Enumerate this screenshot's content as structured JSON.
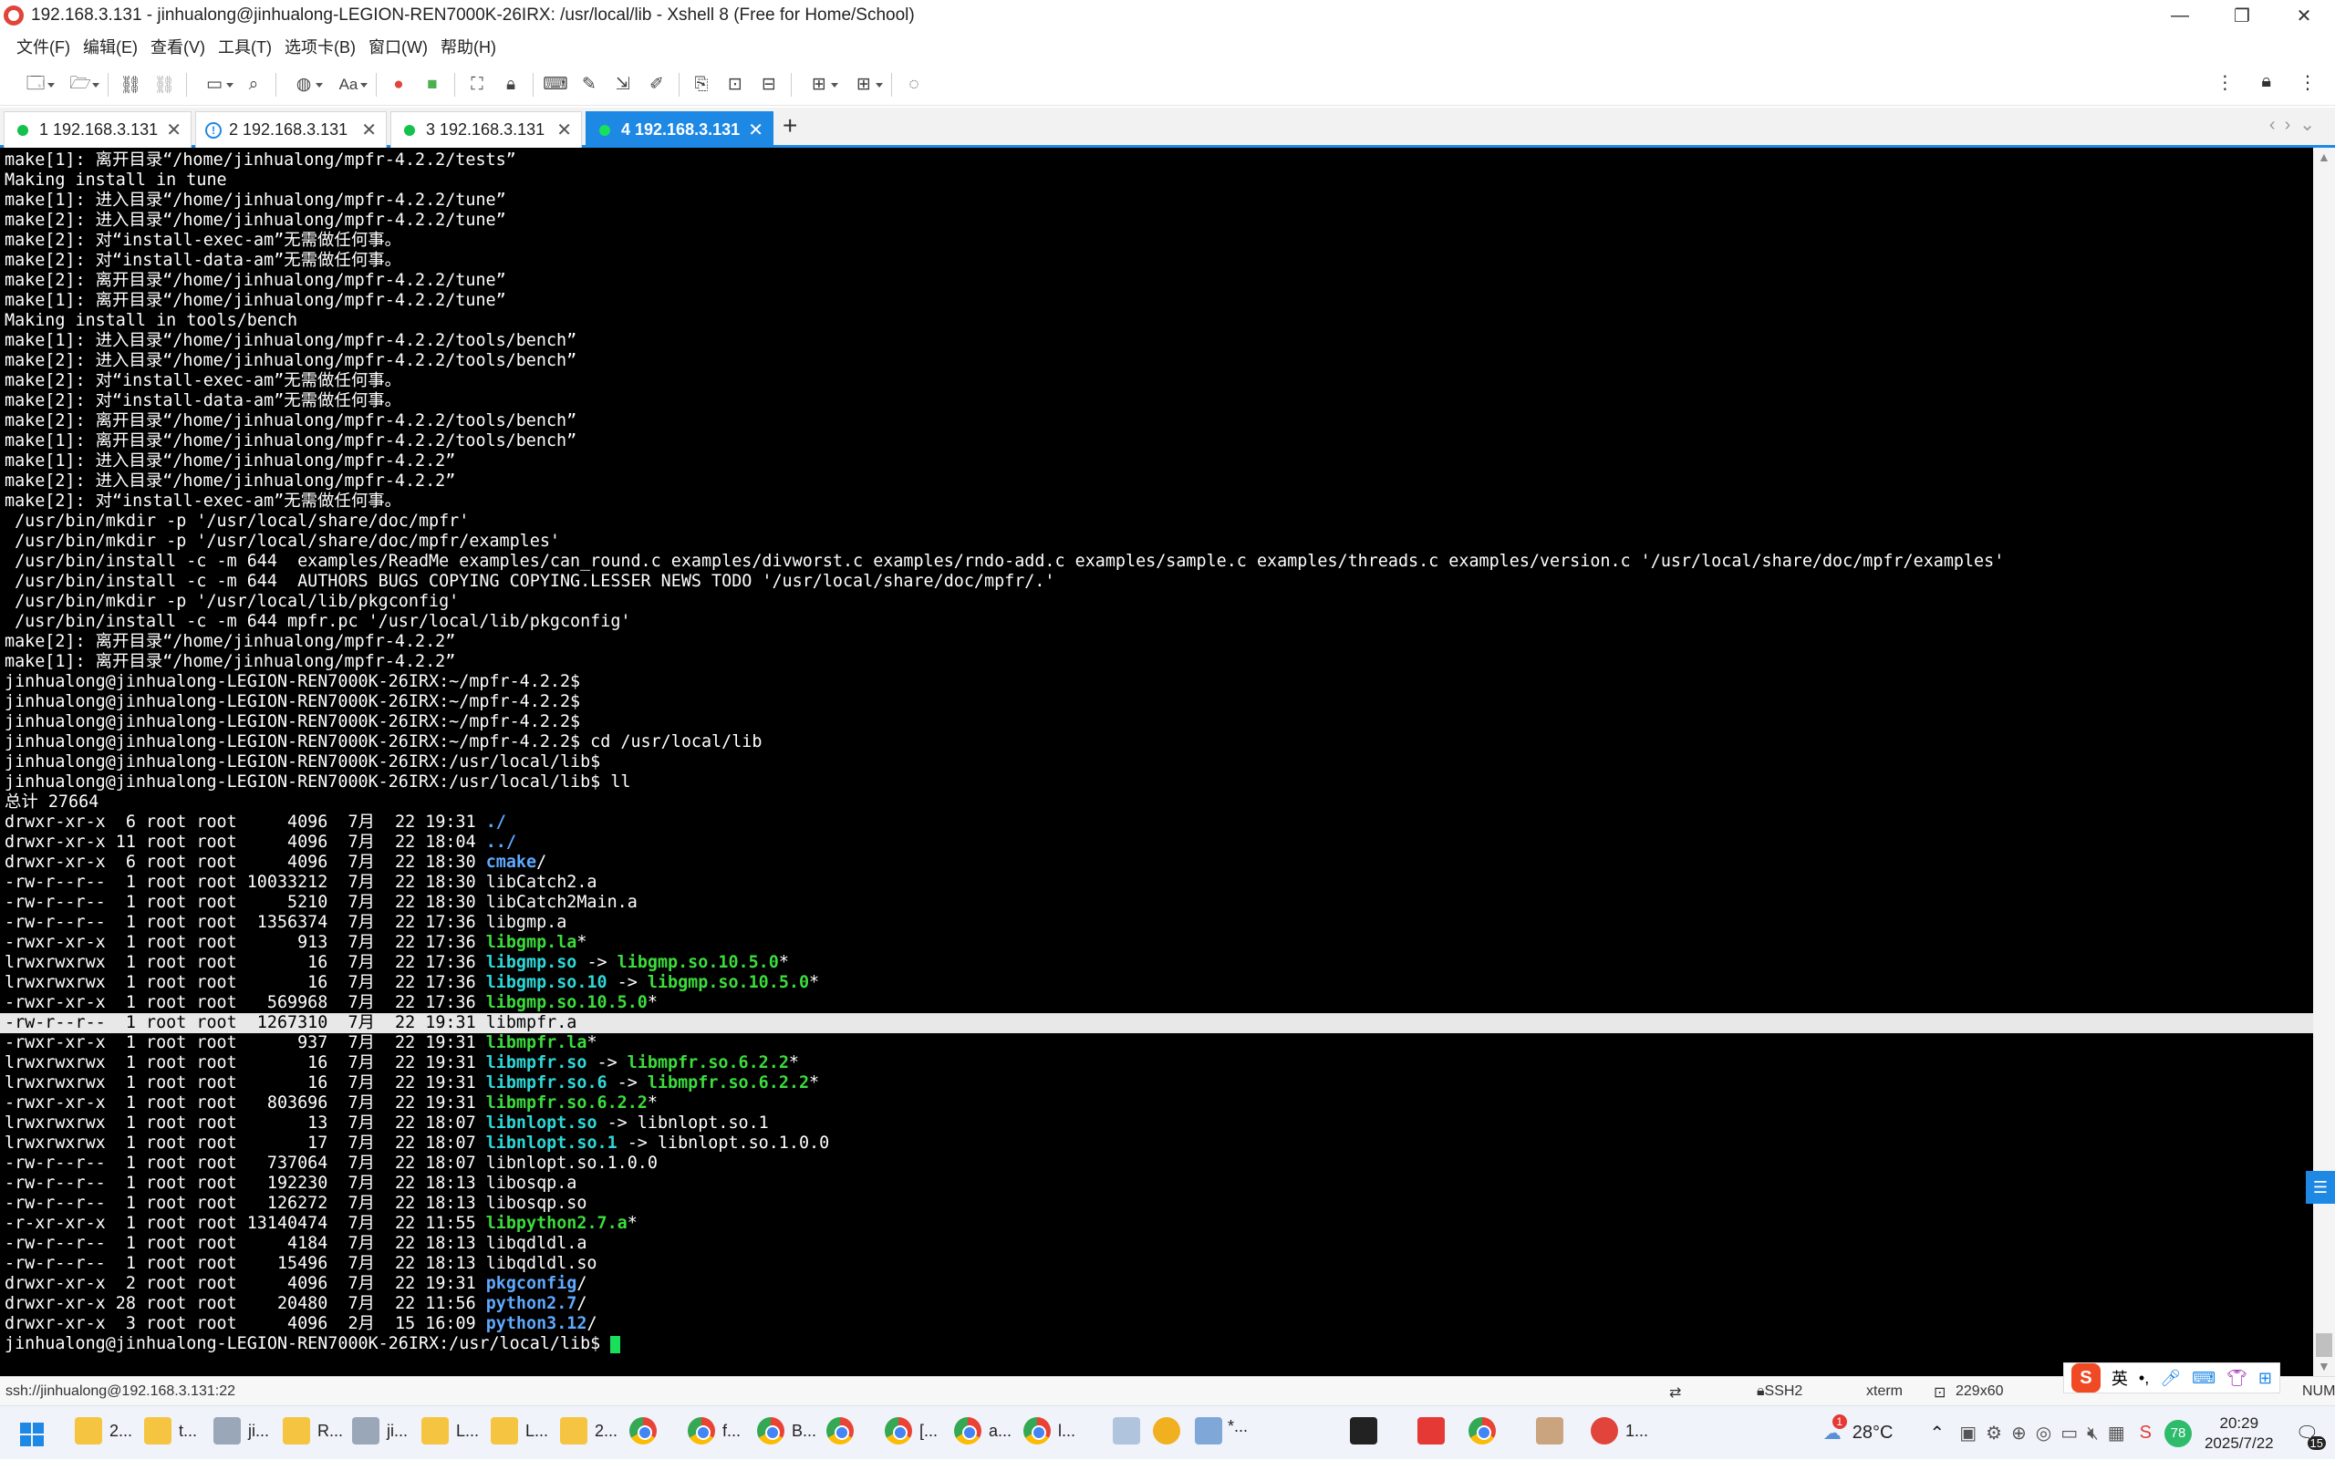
{
  "window": {
    "title": "192.168.3.131 - jinhualong@jinhualong-LEGION-REN7000K-26IRX: /usr/local/lib - Xshell 8 (Free for Home/School)",
    "controls": {
      "minimize": "—",
      "maximize": "❐",
      "close": "✕"
    }
  },
  "menu": [
    "文件(F)",
    "编辑(E)",
    "查看(V)",
    "工具(T)",
    "选项卡(B)",
    "窗口(W)",
    "帮助(H)"
  ],
  "toolbar": {
    "buttons": [
      "new-session-icon",
      "open-icon",
      "connect-icon",
      "disconnect-icon",
      "new-window-icon",
      "find-icon",
      "globe-icon",
      "font-icon",
      "xftp-icon",
      "xmanager-icon",
      "fullscreen-icon",
      "lock-icon",
      "keyboard-icon",
      "compose-icon",
      "script-icon",
      "macro-icon",
      "log-icon",
      "tile-icon",
      "transfer-icon",
      "layout-icon",
      "chat-icon"
    ],
    "font_label": "Aa",
    "right": [
      "more-icon",
      "lock-icon"
    ]
  },
  "tabs": [
    {
      "label": "1 192.168.3.131",
      "state": "connected"
    },
    {
      "label": "2 192.168.3.131",
      "state": "warning"
    },
    {
      "label": "3 192.168.3.131",
      "state": "connected"
    },
    {
      "label": "4 192.168.3.131",
      "state": "active"
    }
  ],
  "terminal": {
    "lines": [
      [
        [
          "make[1]: 离开目录“/home/jinhualong/mpfr-4.2.2/tests”",
          ""
        ]
      ],
      [
        [
          "Making install in tune",
          ""
        ]
      ],
      [
        [
          "make[1]: 进入目录“/home/jinhualong/mpfr-4.2.2/tune”",
          ""
        ]
      ],
      [
        [
          "make[2]: 进入目录“/home/jinhualong/mpfr-4.2.2/tune”",
          ""
        ]
      ],
      [
        [
          "make[2]: 对“install-exec-am”无需做任何事。",
          ""
        ]
      ],
      [
        [
          "make[2]: 对“install-data-am”无需做任何事。",
          ""
        ]
      ],
      [
        [
          "make[2]: 离开目录“/home/jinhualong/mpfr-4.2.2/tune”",
          ""
        ]
      ],
      [
        [
          "make[1]: 离开目录“/home/jinhualong/mpfr-4.2.2/tune”",
          ""
        ]
      ],
      [
        [
          "Making install in tools/bench",
          ""
        ]
      ],
      [
        [
          "make[1]: 进入目录“/home/jinhualong/mpfr-4.2.2/tools/bench”",
          ""
        ]
      ],
      [
        [
          "make[2]: 进入目录“/home/jinhualong/mpfr-4.2.2/tools/bench”",
          ""
        ]
      ],
      [
        [
          "make[2]: 对“install-exec-am”无需做任何事。",
          ""
        ]
      ],
      [
        [
          "make[2]: 对“install-data-am”无需做任何事。",
          ""
        ]
      ],
      [
        [
          "make[2]: 离开目录“/home/jinhualong/mpfr-4.2.2/tools/bench”",
          ""
        ]
      ],
      [
        [
          "make[1]: 离开目录“/home/jinhualong/mpfr-4.2.2/tools/bench”",
          ""
        ]
      ],
      [
        [
          "make[1]: 进入目录“/home/jinhualong/mpfr-4.2.2”",
          ""
        ]
      ],
      [
        [
          "make[2]: 进入目录“/home/jinhualong/mpfr-4.2.2”",
          ""
        ]
      ],
      [
        [
          "make[2]: 对“install-exec-am”无需做任何事。",
          ""
        ]
      ],
      [
        [
          " /usr/bin/mkdir -p '/usr/local/share/doc/mpfr'",
          ""
        ]
      ],
      [
        [
          " /usr/bin/mkdir -p '/usr/local/share/doc/mpfr/examples'",
          ""
        ]
      ],
      [
        [
          " /usr/bin/install -c -m 644  examples/ReadMe examples/can_round.c examples/divworst.c examples/rndo-add.c examples/sample.c examples/threads.c examples/version.c '/usr/local/share/doc/mpfr/examples'",
          ""
        ]
      ],
      [
        [
          " /usr/bin/install -c -m 644  AUTHORS BUGS COPYING COPYING.LESSER NEWS TODO '/usr/local/share/doc/mpfr/.'",
          ""
        ]
      ],
      [
        [
          " /usr/bin/mkdir -p '/usr/local/lib/pkgconfig'",
          ""
        ]
      ],
      [
        [
          " /usr/bin/install -c -m 644 mpfr.pc '/usr/local/lib/pkgconfig'",
          ""
        ]
      ],
      [
        [
          "make[2]: 离开目录“/home/jinhualong/mpfr-4.2.2”",
          ""
        ]
      ],
      [
        [
          "make[1]: 离开目录“/home/jinhualong/mpfr-4.2.2”",
          ""
        ]
      ],
      [
        [
          "jinhualong@jinhualong-LEGION-REN7000K-26IRX:~/mpfr-4.2.2$",
          ""
        ]
      ],
      [
        [
          "jinhualong@jinhualong-LEGION-REN7000K-26IRX:~/mpfr-4.2.2$",
          ""
        ]
      ],
      [
        [
          "jinhualong@jinhualong-LEGION-REN7000K-26IRX:~/mpfr-4.2.2$",
          ""
        ]
      ],
      [
        [
          "jinhualong@jinhualong-LEGION-REN7000K-26IRX:~/mpfr-4.2.2$ cd /usr/local/lib",
          ""
        ]
      ],
      [
        [
          "jinhualong@jinhualong-LEGION-REN7000K-26IRX:/usr/local/lib$",
          ""
        ]
      ],
      [
        [
          "jinhualong@jinhualong-LEGION-REN7000K-26IRX:/usr/local/lib$ ll",
          ""
        ]
      ],
      [
        [
          "总计 27664",
          ""
        ]
      ],
      [
        [
          "drwxr-xr-x  6 root root     4096  7月  22 19:31 ",
          ""
        ],
        [
          "./",
          "b"
        ]
      ],
      [
        [
          "drwxr-xr-x 11 root root     4096  7月  22 18:04 ",
          ""
        ],
        [
          "../",
          "b"
        ]
      ],
      [
        [
          "drwxr-xr-x  6 root root     4096  7月  22 18:30 ",
          ""
        ],
        [
          "cmake",
          "b"
        ],
        [
          "/",
          ""
        ]
      ],
      [
        [
          "-rw-r--r--  1 root root 10033212  7月  22 18:30 libCatch2.a",
          ""
        ]
      ],
      [
        [
          "-rw-r--r--  1 root root     5210  7月  22 18:30 libCatch2Main.a",
          ""
        ]
      ],
      [
        [
          "-rw-r--r--  1 root root  1356374  7月  22 17:36 libgmp.a",
          ""
        ]
      ],
      [
        [
          "-rwxr-xr-x  1 root root      913  7月  22 17:36 ",
          ""
        ],
        [
          "libgmp.la",
          "g"
        ],
        [
          "*",
          ""
        ]
      ],
      [
        [
          "lrwxrwxrwx  1 root root       16  7月  22 17:36 ",
          ""
        ],
        [
          "libgmp.so",
          "c"
        ],
        [
          " -> ",
          ""
        ],
        [
          "libgmp.so.10.5.0",
          "g"
        ],
        [
          "*",
          ""
        ]
      ],
      [
        [
          "lrwxrwxrwx  1 root root       16  7月  22 17:36 ",
          ""
        ],
        [
          "libgmp.so.10",
          "c"
        ],
        [
          " -> ",
          ""
        ],
        [
          "libgmp.so.10.5.0",
          "g"
        ],
        [
          "*",
          ""
        ]
      ],
      [
        [
          "-rwxr-xr-x  1 root root   569968  7月  22 17:36 ",
          ""
        ],
        [
          "libgmp.so.10.5.0",
          "g"
        ],
        [
          "*",
          ""
        ]
      ],
      [
        [
          "-rw-r--r--  1 root root  1267310  7月  22 19:31 libmpfr.a",
          "hl"
        ]
      ],
      [
        [
          "-rwxr-xr-x  1 root root      937  7月  22 19:31 ",
          ""
        ],
        [
          "libmpfr.la",
          "g"
        ],
        [
          "*",
          ""
        ]
      ],
      [
        [
          "lrwxrwxrwx  1 root root       16  7月  22 19:31 ",
          ""
        ],
        [
          "libmpfr.so",
          "c"
        ],
        [
          " -> ",
          ""
        ],
        [
          "libmpfr.so.6.2.2",
          "g"
        ],
        [
          "*",
          ""
        ]
      ],
      [
        [
          "lrwxrwxrwx  1 root root       16  7月  22 19:31 ",
          ""
        ],
        [
          "libmpfr.so.6",
          "c"
        ],
        [
          " -> ",
          ""
        ],
        [
          "libmpfr.so.6.2.2",
          "g"
        ],
        [
          "*",
          ""
        ]
      ],
      [
        [
          "-rwxr-xr-x  1 root root   803696  7月  22 19:31 ",
          ""
        ],
        [
          "libmpfr.so.6.2.2",
          "g"
        ],
        [
          "*",
          ""
        ]
      ],
      [
        [
          "lrwxrwxrwx  1 root root       13  7月  22 18:07 ",
          ""
        ],
        [
          "libnlopt.so",
          "c"
        ],
        [
          " -> libnlopt.so.1",
          ""
        ]
      ],
      [
        [
          "lrwxrwxrwx  1 root root       17  7月  22 18:07 ",
          ""
        ],
        [
          "libnlopt.so.1",
          "c"
        ],
        [
          " -> libnlopt.so.1.0.0",
          ""
        ]
      ],
      [
        [
          "-rw-r--r--  1 root root   737064  7月  22 18:07 libnlopt.so.1.0.0",
          ""
        ]
      ],
      [
        [
          "-rw-r--r--  1 root root   192230  7月  22 18:13 libosqp.a",
          ""
        ]
      ],
      [
        [
          "-rw-r--r--  1 root root   126272  7月  22 18:13 libosqp.so",
          ""
        ]
      ],
      [
        [
          "-r-xr-xr-x  1 root root 13140474  7月  22 11:55 ",
          ""
        ],
        [
          "libpython2.7.a",
          "g"
        ],
        [
          "*",
          ""
        ]
      ],
      [
        [
          "-rw-r--r--  1 root root     4184  7月  22 18:13 libqdldl.a",
          ""
        ]
      ],
      [
        [
          "-rw-r--r--  1 root root    15496  7月  22 18:13 libqdldl.so",
          ""
        ]
      ],
      [
        [
          "drwxr-xr-x  2 root root     4096  7月  22 19:31 ",
          ""
        ],
        [
          "pkgconfig",
          "b"
        ],
        [
          "/",
          ""
        ]
      ],
      [
        [
          "drwxr-xr-x 28 root root    20480  7月  22 11:56 ",
          ""
        ],
        [
          "python2.7",
          "b"
        ],
        [
          "/",
          ""
        ]
      ],
      [
        [
          "drwxr-xr-x  3 root root     4096  2月  15 16:09 ",
          ""
        ],
        [
          "python3.12",
          "b"
        ],
        [
          "/",
          ""
        ]
      ],
      [
        [
          "jinhualong@jinhualong-LEGION-REN7000K-26IRX:/usr/local/lib$ ",
          "cursor"
        ]
      ]
    ]
  },
  "statusbar": {
    "connection": "ssh://jinhualong@192.168.3.131:22",
    "protocol": "SSH2",
    "term": "xterm",
    "size": "229x60",
    "num": "NUM"
  },
  "ime": {
    "lang": "英"
  },
  "taskbar": {
    "items": [
      {
        "icon": "folder",
        "label": "2..."
      },
      {
        "icon": "folder",
        "label": "t..."
      },
      {
        "icon": "drive",
        "label": "ji..."
      },
      {
        "icon": "folder",
        "label": "R..."
      },
      {
        "icon": "drive",
        "label": "ji..."
      },
      {
        "icon": "folder",
        "label": "L..."
      },
      {
        "icon": "folder",
        "label": "L..."
      },
      {
        "icon": "folder",
        "label": "2..."
      },
      {
        "icon": "chrome",
        "label": ""
      },
      {
        "icon": "chrome",
        "label": "f..."
      },
      {
        "icon": "chrome",
        "label": "B..."
      },
      {
        "icon": "chrome",
        "label": ""
      },
      {
        "icon": "chrome",
        "label": "[..."
      },
      {
        "icon": "chrome",
        "label": "a..."
      },
      {
        "icon": "chrome",
        "label": "l..."
      }
    ],
    "xshell_label": "1...",
    "weather": "28°C",
    "weather_badge": "1",
    "battery": "78",
    "time": "20:29",
    "date": "2025/7/22",
    "notifications": "15"
  }
}
